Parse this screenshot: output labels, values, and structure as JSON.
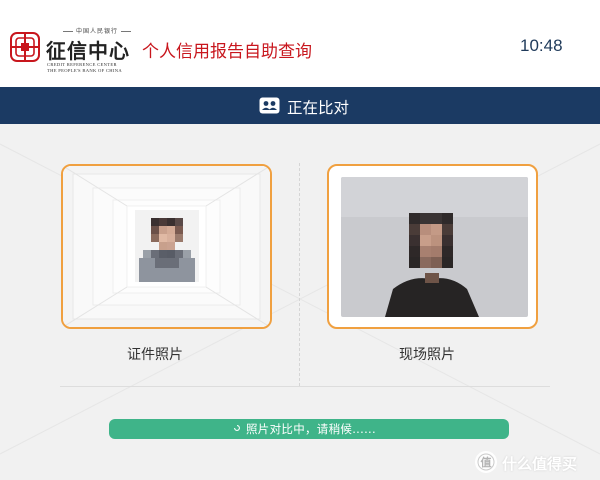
{
  "header": {
    "logo": {
      "top_text": "中国人民银行",
      "main_text": "征信中心",
      "en_line1": "CREDIT REFERENCE CENTER",
      "en_line2": "THE PEOPLE'S BANK OF CHINA"
    },
    "app_title": "个人信用报告自助查询",
    "time": "10:48"
  },
  "status": {
    "icon": "compare-faces-icon",
    "text": "正在比对"
  },
  "photos": {
    "id_label": "证件照片",
    "live_label": "现场照片"
  },
  "progress": {
    "spinner_icon": "spinner-icon",
    "text": "照片对比中，请稍候......"
  },
  "watermark": {
    "icon": "watermark-logo-icon",
    "text": "什么值得买"
  },
  "colors": {
    "brand_red": "#c8161d",
    "header_bar": "#1b3a63",
    "card_border": "#f0a040",
    "progress_green": "#3fb489"
  }
}
